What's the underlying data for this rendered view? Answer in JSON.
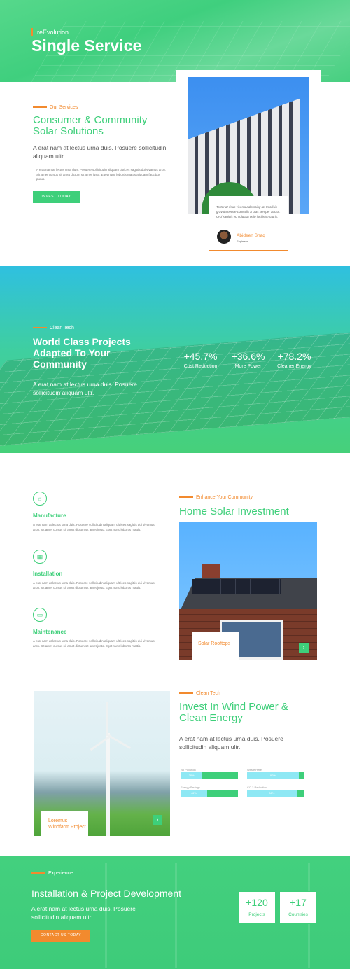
{
  "hero": {
    "subtitle": "reEvolution",
    "title": "Single Service"
  },
  "services": {
    "eyebrow": "Our Services",
    "title": "Consumer & Community Solar Solutions",
    "lead": "A erat nam at lectus urna duis. Posuere sollicitudin aliquam ultr.",
    "body": "A erat nam at lectus urna duis. Posuere sollicitudin aliquam ultrices sagittis dui vivamus arcu. Sit amet cursus sit amet dictum sit amet justo. Eget nunc lobortis mattis aliquam faucibus purus.",
    "button": "INVEST TODAY",
    "quote": {
      "text": "Tortor at risus viverra adipiscing at. Facilisis gravida neque convallis a cras semper auctor. Orci sagittis eu volutpat odio facilisis mauris.",
      "name": "Abideen Shaq",
      "role": "Engineer"
    }
  },
  "projects": {
    "eyebrow": "Clean Tech",
    "title": "World Class Projects Adapted To Your Community",
    "lead": "A erat nam at lectus urna duis. Posuere sollicitudin aliquam ultr.",
    "stats": [
      {
        "value": "+45.7%",
        "label": "Cost Reduction"
      },
      {
        "value": "+36.6%",
        "label": "More Power"
      },
      {
        "value": "+78.2%",
        "label": "Cleaner Energy"
      }
    ]
  },
  "features": [
    {
      "icon": "sun-icon",
      "glyph": "☼",
      "title": "Manufacture",
      "text": "A erat nam at lectus urna duis. Posuere sollicitudin aliquam ultrices sagittis dui vivamus arcu. Sit amet cursus sit amet dictum sit amet justo. Eget nunc lobortis mattis."
    },
    {
      "icon": "solar-panel-icon",
      "glyph": "▦",
      "title": "Installation",
      "text": "A erat nam at lectus urna duis. Posuere sollicitudin aliquam ultrices sagittis dui vivamus arcu. Sit amet cursus sit amet dictum sit amet justo. Eget nunc lobortis mattis."
    },
    {
      "icon": "battery-icon",
      "glyph": "▭",
      "title": "Maintenance",
      "text": "A erat nam at lectus urna duis. Posuere sollicitudin aliquam ultrices sagittis dui vivamus arcu. Sit amet cursus sit amet dictum sit amet justo. Eget nunc lobortis mattis."
    }
  ],
  "home": {
    "eyebrow": "Enhance Your Community",
    "title": "Home Solar Investment",
    "image_label": "Solar Rooftops"
  },
  "wind": {
    "image_label": "Loremus Windfarm Project",
    "eyebrow": "Clean Tech",
    "title": "Invest In Wind Power & Clean Energy",
    "lead": "A erat nam at lectus urna duis. Posuere sollicitudin aliquam ultr.",
    "bars": [
      {
        "label": "No Pollution",
        "value": "38%",
        "fraction": 0.38
      },
      {
        "label": "Waste Here",
        "value": "90%",
        "fraction": 0.9
      },
      {
        "label": "Energy Savings",
        "value": "46%",
        "fraction": 0.46
      },
      {
        "label": "CO 2 Reduction",
        "value": "86%",
        "fraction": 0.86
      }
    ]
  },
  "experience": {
    "eyebrow": "Experience",
    "title": "Installation & Project Development",
    "lead": "A erat nam at lectus urna duis. Posuere sollicitudin aliquam ultr.",
    "button": "CONTACT US TODAY",
    "counters": [
      {
        "value": "+120",
        "label": "Projects"
      },
      {
        "value": "+17",
        "label": "Countries"
      }
    ]
  }
}
